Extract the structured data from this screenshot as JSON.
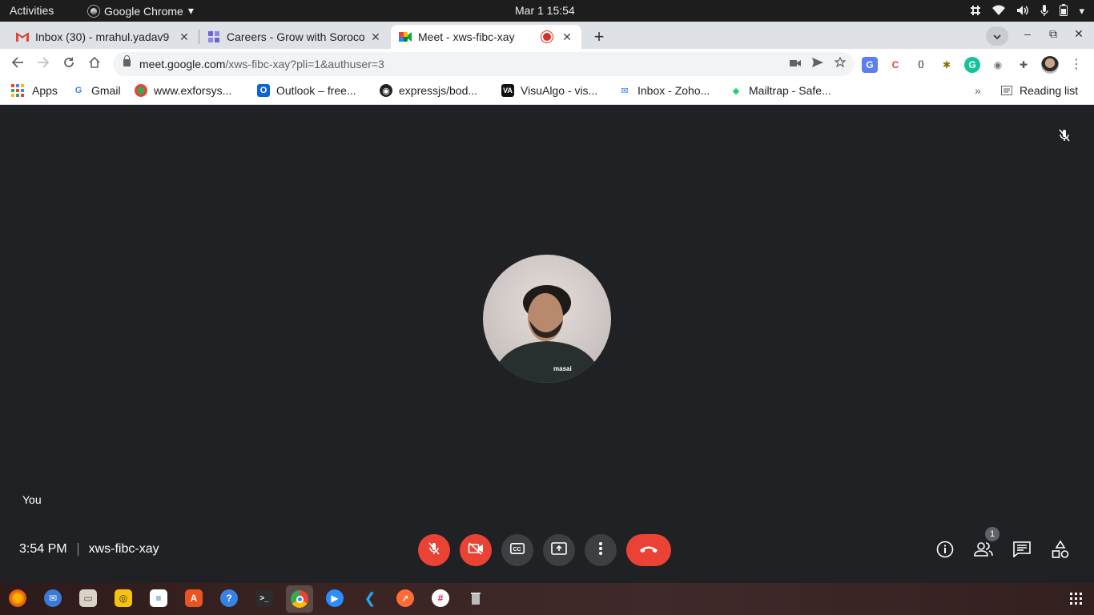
{
  "os": {
    "activities": "Activities",
    "app_name": "Google Chrome",
    "app_arrow": "▾",
    "clock": "Mar 1  15:54"
  },
  "tabs": [
    {
      "title": "Inbox (30) - mrahul.yadav9",
      "close": "✕"
    },
    {
      "title": "Careers - Grow with Soroco",
      "close": "✕"
    },
    {
      "title": "Meet - xws-fibc-xay",
      "close": "✕"
    }
  ],
  "new_tab": "+",
  "address": {
    "host": "meet.google.com",
    "path": "/xws-fibc-xay?pli=1&authuser=3"
  },
  "bookmarks": [
    {
      "label": "Apps"
    },
    {
      "label": "Gmail"
    },
    {
      "label": "www.exforsys..."
    },
    {
      "label": "Outlook – free..."
    },
    {
      "label": "expressjs/bod..."
    },
    {
      "label": "VisuAlgo - vis..."
    },
    {
      "label": "Inbox - Zoho..."
    },
    {
      "label": "Mailtrap - Safe..."
    }
  ],
  "bookmarks_more": "»",
  "reading_list": "Reading list",
  "meet": {
    "self_label": "You",
    "time": "3:54 PM",
    "meeting_code": "xws-fibc-xay",
    "participant_count": "1"
  },
  "colors": {
    "meet_bg": "#202124",
    "control_bg": "#3c4043",
    "danger": "#ea4335"
  }
}
